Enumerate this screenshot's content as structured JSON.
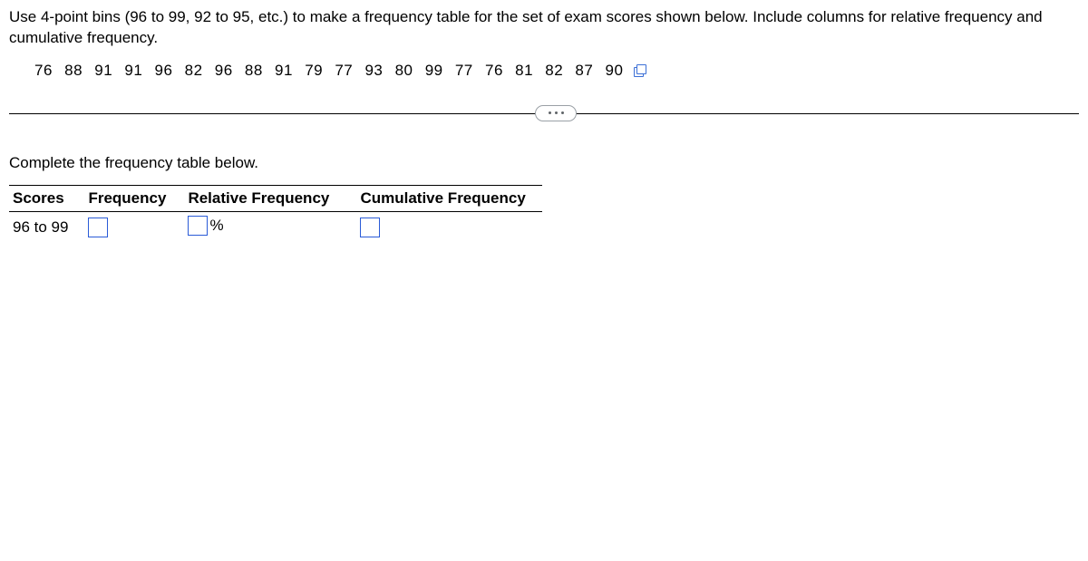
{
  "question": "Use 4-point bins (96 to 99, 92 to 95, etc.) to make a frequency table for the set of exam scores shown below. Include columns for relative frequency and cumulative frequency.",
  "dataset": "76  88  91  91  96  82  96  88  91  79  77  93  80  99  77  76  81  82  87  90",
  "instruction": "Complete the frequency table below.",
  "table": {
    "headers": {
      "scores": "Scores",
      "frequency": "Frequency",
      "relative": "Relative Frequency",
      "cumulative": "Cumulative Frequency"
    },
    "row": {
      "scores": "96 to 99",
      "pct_symbol": "%"
    }
  }
}
